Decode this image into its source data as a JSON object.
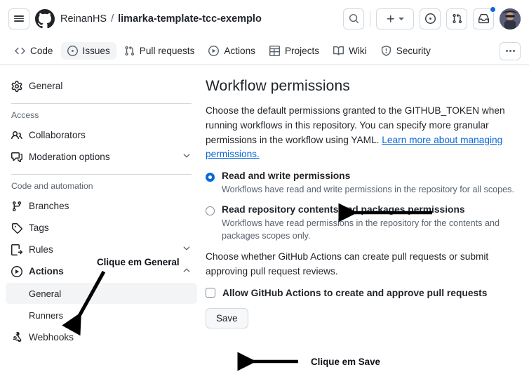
{
  "header": {
    "menu_icon": "hamburger-icon",
    "logo_icon": "github-logo-icon",
    "owner": "ReinanHS",
    "separator": "/",
    "repo": "limarka-template-tcc-exemplo",
    "actions": {
      "search_icon": "search-icon",
      "create_new_icon": "plus-icon",
      "create_new_caret_icon": "chevron-down-icon",
      "issues_icon": "issue-opened-icon",
      "pull_requests_icon": "git-pull-request-icon",
      "notifications_icon": "inbox-icon",
      "notifications_badge": true,
      "avatar_icon": "user-avatar"
    }
  },
  "repo_nav": {
    "items": [
      {
        "label": "Code",
        "icon": "code-icon",
        "active": false
      },
      {
        "label": "Issues",
        "icon": "issue-opened-icon",
        "active": true
      },
      {
        "label": "Pull requests",
        "icon": "git-pull-request-icon",
        "active": false
      },
      {
        "label": "Actions",
        "icon": "play-circle-icon",
        "active": false
      },
      {
        "label": "Projects",
        "icon": "table-icon",
        "active": false
      },
      {
        "label": "Wiki",
        "icon": "book-icon",
        "active": false
      },
      {
        "label": "Security",
        "icon": "shield-icon",
        "active": false
      }
    ],
    "overflow_icon": "kebab-horizontal-icon"
  },
  "sidebar": {
    "top": {
      "label": "General",
      "icon": "gear-icon"
    },
    "sections": [
      {
        "heading": "Access",
        "items": [
          {
            "label": "Collaborators",
            "icon": "people-icon",
            "chevron": null
          },
          {
            "label": "Moderation options",
            "icon": "comment-discussion-icon",
            "chevron": "chevron-down-icon"
          }
        ]
      },
      {
        "heading": "Code and automation",
        "items": [
          {
            "label": "Branches",
            "icon": "git-branch-icon",
            "chevron": null
          },
          {
            "label": "Tags",
            "icon": "tag-icon",
            "chevron": null
          },
          {
            "label": "Rules",
            "icon": "rules-icon",
            "chevron": "chevron-down-icon"
          },
          {
            "label": "Actions",
            "icon": "play-circle-icon",
            "chevron": "chevron-up-icon",
            "expanded": true
          },
          {
            "label": "Webhooks",
            "icon": "webhook-icon",
            "chevron": null
          }
        ]
      }
    ],
    "actions_subitems": [
      {
        "label": "General",
        "selected": true
      },
      {
        "label": "Runners",
        "selected": false
      }
    ]
  },
  "main": {
    "title": "Workflow permissions",
    "description_part1": "Choose the default permissions granted to the GITHUB_TOKEN when running workflows in this repository. You can specify more granular permissions in the workflow using YAML. ",
    "description_link": "Learn more about managing permissions.",
    "permissions": [
      {
        "label": "Read and write permissions",
        "description": "Workflows have read and write permissions in the repository for all scopes.",
        "selected": true
      },
      {
        "label": "Read repository contents and packages permissions",
        "description": "Workflows have read permissions in the repository for the contents and packages scopes only.",
        "selected": false
      }
    ],
    "pr_description": "Choose whether GitHub Actions can create pull requests or submit approving pull request reviews.",
    "allow_checkbox": {
      "label": "Allow GitHub Actions to create and approve pull requests",
      "checked": false
    },
    "save_label": "Save"
  },
  "annotations": [
    {
      "text": "Clique em General",
      "arrow": "diagonal-down-left"
    },
    {
      "text": "Clique em Save",
      "arrow": "left"
    }
  ],
  "colors": {
    "accent": "#0969da",
    "text": "#1f2328",
    "muted": "#59636e",
    "border": "#d1d9e0",
    "surface": "#f6f8fa"
  }
}
